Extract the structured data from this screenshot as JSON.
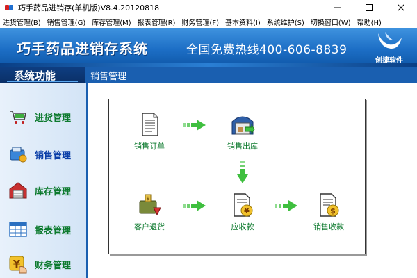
{
  "window": {
    "title": "巧手药品进销存(单机版)V8.4.20120818"
  },
  "menu": [
    "进货管理(B)",
    "销售管理(G)",
    "库存管理(M)",
    "报表管理(R)",
    "财务管理(F)",
    "基本资料(I)",
    "系统维护(S)",
    "切换窗口(W)",
    "帮助(H)"
  ],
  "banner": {
    "title": "巧手药品进销存系统",
    "hotline": "全国免费热线400-606-8839",
    "logo_text": "创捷软件"
  },
  "header": {
    "sidebar_title": "系统功能",
    "page_title": "销售管理"
  },
  "sidebar": {
    "items": [
      {
        "label": "进货管理",
        "icon": "cart-icon",
        "active": false
      },
      {
        "label": "销售管理",
        "icon": "sales-icon",
        "active": true
      },
      {
        "label": "库存管理",
        "icon": "warehouse-icon",
        "active": false
      },
      {
        "label": "报表管理",
        "icon": "table-icon",
        "active": false
      },
      {
        "label": "财务管理",
        "icon": "finance-icon",
        "active": false
      }
    ]
  },
  "flow": {
    "nodes": [
      {
        "id": "order",
        "label": "销售订单",
        "icon": "document-icon"
      },
      {
        "id": "outbound",
        "label": "销售出库",
        "icon": "warehouse-out-icon"
      },
      {
        "id": "return",
        "label": "客户退货",
        "icon": "return-bag-icon"
      },
      {
        "id": "receivable",
        "label": "应收款",
        "icon": "receivable-icon"
      },
      {
        "id": "collection",
        "label": "销售收款",
        "icon": "collection-icon"
      }
    ]
  },
  "colors": {
    "banner_blue": "#1d6fc6",
    "dark_blue": "#0a2f66",
    "nav_green": "#0d7a2e",
    "nav_active": "#0b3fa8",
    "arrow_green": "#3fbf3f"
  }
}
